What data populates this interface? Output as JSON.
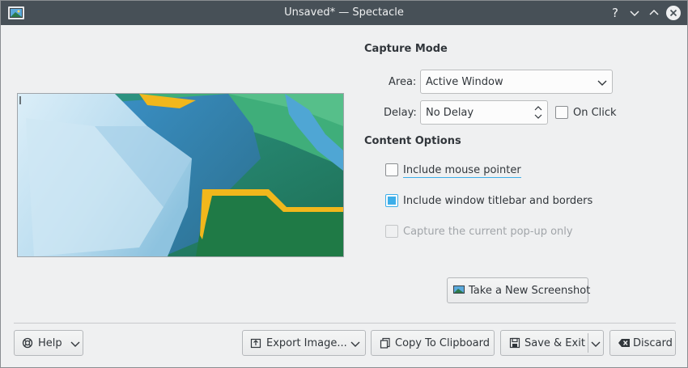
{
  "window": {
    "title": "Unsaved* — Spectacle",
    "buttons": {
      "help": "help-icon",
      "minimize": "minimize-icon",
      "maximize": "maximize-icon",
      "close": "close-icon"
    }
  },
  "capture_mode": {
    "heading": "Capture Mode",
    "area_label": "Area:",
    "area_value": "Active Window",
    "delay_label": "Delay:",
    "delay_value": "No Delay",
    "on_click_label": "On Click",
    "on_click_checked": false
  },
  "content_options": {
    "heading": "Content Options",
    "options": [
      {
        "label": "Include mouse pointer",
        "checked": false,
        "enabled": true
      },
      {
        "label": "Include window titlebar and borders",
        "checked": true,
        "enabled": true
      },
      {
        "label": "Capture the current pop-up only",
        "checked": false,
        "enabled": false
      }
    ]
  },
  "new_screenshot_button": "Take a New Screenshot",
  "footer": {
    "help": "Help",
    "export": "Export Image...",
    "copy": "Copy To Clipboard",
    "save": "Save & Exit",
    "discard": "Discard"
  },
  "colors": {
    "titlebar": "#475057",
    "accent": "#3daee9",
    "background": "#eff0f1"
  }
}
